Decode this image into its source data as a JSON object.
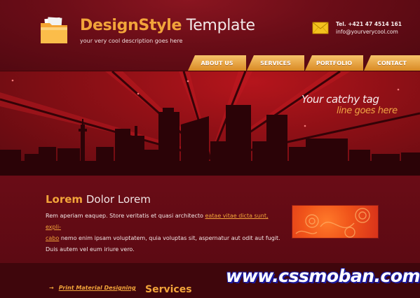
{
  "header": {
    "brand_strong": "DesignStyle",
    "brand_light": "Template",
    "tagline": "your very cool description goes here",
    "logo_icon": "folder-icon",
    "mail_icon": "envelope-icon",
    "phone": "Tel. +421 47 4514 161",
    "email": "info@yourverycool.com"
  },
  "nav": {
    "items": [
      {
        "label": "ABOUT US"
      },
      {
        "label": "SERVICES"
      },
      {
        "label": "PORTFOLIO"
      },
      {
        "label": "CONTACT"
      }
    ]
  },
  "hero": {
    "catch_line_1": "Your catchy tag",
    "catch_line_2": "line goes here"
  },
  "content": {
    "title_strong": "Lorem",
    "title_light": "Dolor Lorem",
    "text_1": "Rem aperiam eaquep. Store veritatis et quasi architecto ",
    "link_1": "eatae vitae dicta sunt, expli-",
    "link_2": "cabo",
    "text_2": " nemo enim ipsam voluptatem, quia voluptas sit, aspernatur aut odit aut fugit.",
    "text_3": "Duis autem vel eum iriure vero."
  },
  "footer": {
    "link_label": "Print Material Designing",
    "services_heading": "Services",
    "watermark": "www.cssmoban.com"
  },
  "colors": {
    "brand_orange": "#f2a43a",
    "bg_dark_red": "#5a0a12",
    "hero_red": "#b5151c"
  }
}
